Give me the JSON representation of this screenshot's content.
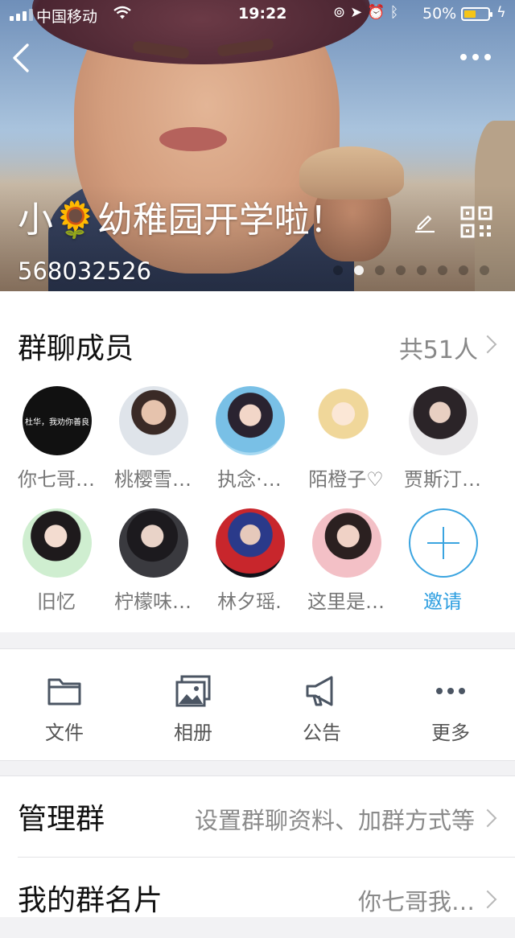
{
  "status_bar": {
    "carrier": "中国移动",
    "time": "19:22",
    "battery_percent": "50%",
    "battery_level": 0.5
  },
  "header": {
    "group_name": "小🌻幼稚园开学啦！",
    "group_number": "568032526",
    "photo_pages": 8,
    "photo_active_page": 1
  },
  "members": {
    "title": "群聊成员",
    "count_label": "共51人",
    "items": [
      {
        "name": "你七哥…",
        "avatar_text": "杜华，我劝你善良"
      },
      {
        "name": "桃樱雪…"
      },
      {
        "name": "执念·…"
      },
      {
        "name": "陌橙子♡"
      },
      {
        "name": "贾斯汀…"
      },
      {
        "name": "旧忆"
      },
      {
        "name": "柠檬味…"
      },
      {
        "name": "林夕瑶."
      },
      {
        "name": "这里是…"
      }
    ],
    "invite_label": "邀请"
  },
  "tools": [
    {
      "label": "文件",
      "icon": "folder-icon"
    },
    {
      "label": "相册",
      "icon": "album-icon"
    },
    {
      "label": "公告",
      "icon": "megaphone-icon"
    },
    {
      "label": "更多",
      "icon": "more-icon"
    }
  ],
  "settings": {
    "manage": {
      "title": "管理群",
      "value": "设置群聊资料、加群方式等"
    },
    "card": {
      "title": "我的群名片",
      "value": "你七哥我…"
    }
  },
  "colors": {
    "accent": "#2d9ee0",
    "battery_fill": "#f5c518",
    "background": "#f2f2f4"
  }
}
